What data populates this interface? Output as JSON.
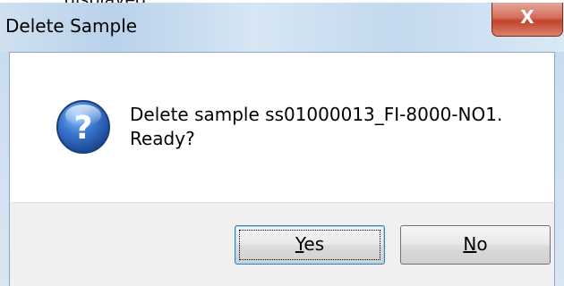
{
  "document": {
    "fragment_text": "displayed."
  },
  "dialog": {
    "title": "Delete Sample",
    "close_glyph": "X",
    "icon": "question-icon",
    "message_line1": "Delete sample ss01000013_FI-8000-NO1.",
    "message_line2": "Ready?",
    "buttons": {
      "yes": {
        "mnemonic": "Y",
        "rest": "es"
      },
      "no": {
        "mnemonic": "N",
        "rest": "o"
      }
    }
  },
  "colors": {
    "titlebar": "#c4d9ee",
    "close_button": "#c3432c",
    "icon_blue": "#2a5caa",
    "default_button_border": "#3c7fb1"
  }
}
